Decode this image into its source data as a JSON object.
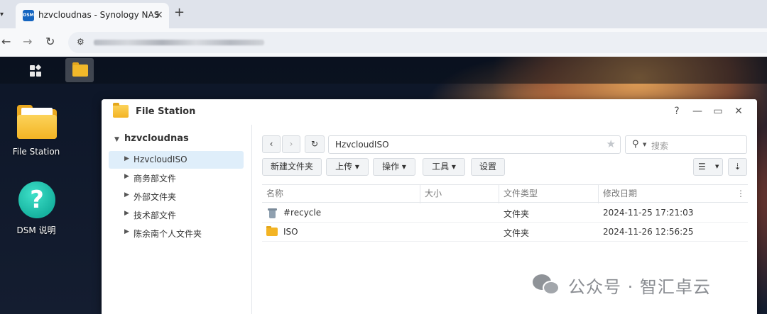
{
  "browser": {
    "tab_title": "hzvcloudnas - Synology NAS",
    "favicon_text": "DSM",
    "new_tab": "+",
    "close": "×"
  },
  "desktop": {
    "icons": [
      {
        "label": "File Station"
      },
      {
        "label": "DSM 说明",
        "glyph": "?"
      }
    ]
  },
  "window": {
    "title": "File Station",
    "controls": {
      "help": "?",
      "minimize": "—",
      "maximize": "▭",
      "close": "✕"
    }
  },
  "sidebar": {
    "root": "hzvcloudnas",
    "items": [
      {
        "label": "HzvcloudISO",
        "active": true
      },
      {
        "label": "商务部文件"
      },
      {
        "label": "外部文件夹"
      },
      {
        "label": "技术部文件"
      },
      {
        "label": "陈余南个人文件夹"
      }
    ]
  },
  "toolbar": {
    "path": "HzvcloudISO",
    "search_placeholder": "搜索",
    "buttons": {
      "new_folder": "新建文件夹",
      "upload": "上传 ▾",
      "action": "操作 ▾",
      "tools": "工具 ▾",
      "settings": "设置"
    }
  },
  "table": {
    "columns": [
      "名称",
      "大小",
      "文件类型",
      "修改日期"
    ],
    "rows": [
      {
        "name": "#recycle",
        "size": "",
        "type": "文件夹",
        "modified": "2024-11-25 17:21:03",
        "icon": "trash-icon"
      },
      {
        "name": "ISO",
        "size": "",
        "type": "文件夹",
        "modified": "2024-11-26 12:56:25",
        "icon": "folder-icon"
      }
    ]
  },
  "watermark": {
    "text": "公众号 · 智汇卓云"
  },
  "colors": {
    "accent": "#dfeefa",
    "folder": "#f3b424",
    "help_teal": "#17b3a0"
  }
}
